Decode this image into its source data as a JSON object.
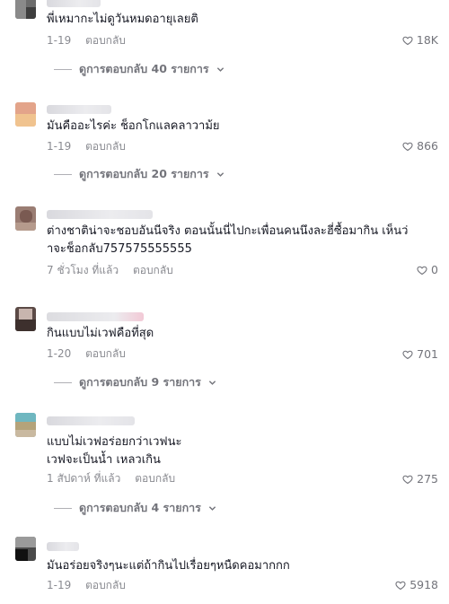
{
  "reply_label": "ตอบกลับ",
  "comments": [
    {
      "text_lines": [
        "พี่เหมากะไม่ดูวันหมดอายุเลยติ"
      ],
      "date": "1-19",
      "likes": "18K",
      "replies_label": "ดูการตอบกลับ 40 รายการ"
    },
    {
      "text_lines": [
        "มันคืออะไรค่ะ ช็อกโกแลคลาวาม้ย"
      ],
      "date": "1-19",
      "likes": "866",
      "replies_label": "ดูการตอบกลับ 20 รายการ"
    },
    {
      "text_lines": [
        "ต่างชาติน่าจะชอบอันนีจริง ตอนนั้นนี่ไปกะเพื่อนคนนึงละฮี่ซื้อมากิน เห็นว่",
        "าจะช็อกลับ757575555555"
      ],
      "date": "7 ชั่วโมง ที่แล้ว",
      "likes": "0",
      "replies_label": ""
    },
    {
      "text_lines": [
        "กินแบบไม่เวฟคือที่สุด"
      ],
      "date": "1-20",
      "likes": "701",
      "replies_label": "ดูการตอบกลับ 9 รายการ"
    },
    {
      "text_lines": [
        "แบบไม่เวฟอร่อยกว่าเวฟนะ",
        "เวฟจะเป็นน้ำ เหลวเกิน"
      ],
      "date": "1 สัปดาห์ ที่แล้ว",
      "likes": "275",
      "replies_label": "ดูการตอบกลับ 4 รายการ"
    },
    {
      "text_lines": [
        "มันอร่อยจริงๆนะแต่ถ้ากินไปเรื่อยๆหนืดคอมากกก"
      ],
      "date": "1-19",
      "likes": "5918",
      "replies_label": ""
    }
  ]
}
